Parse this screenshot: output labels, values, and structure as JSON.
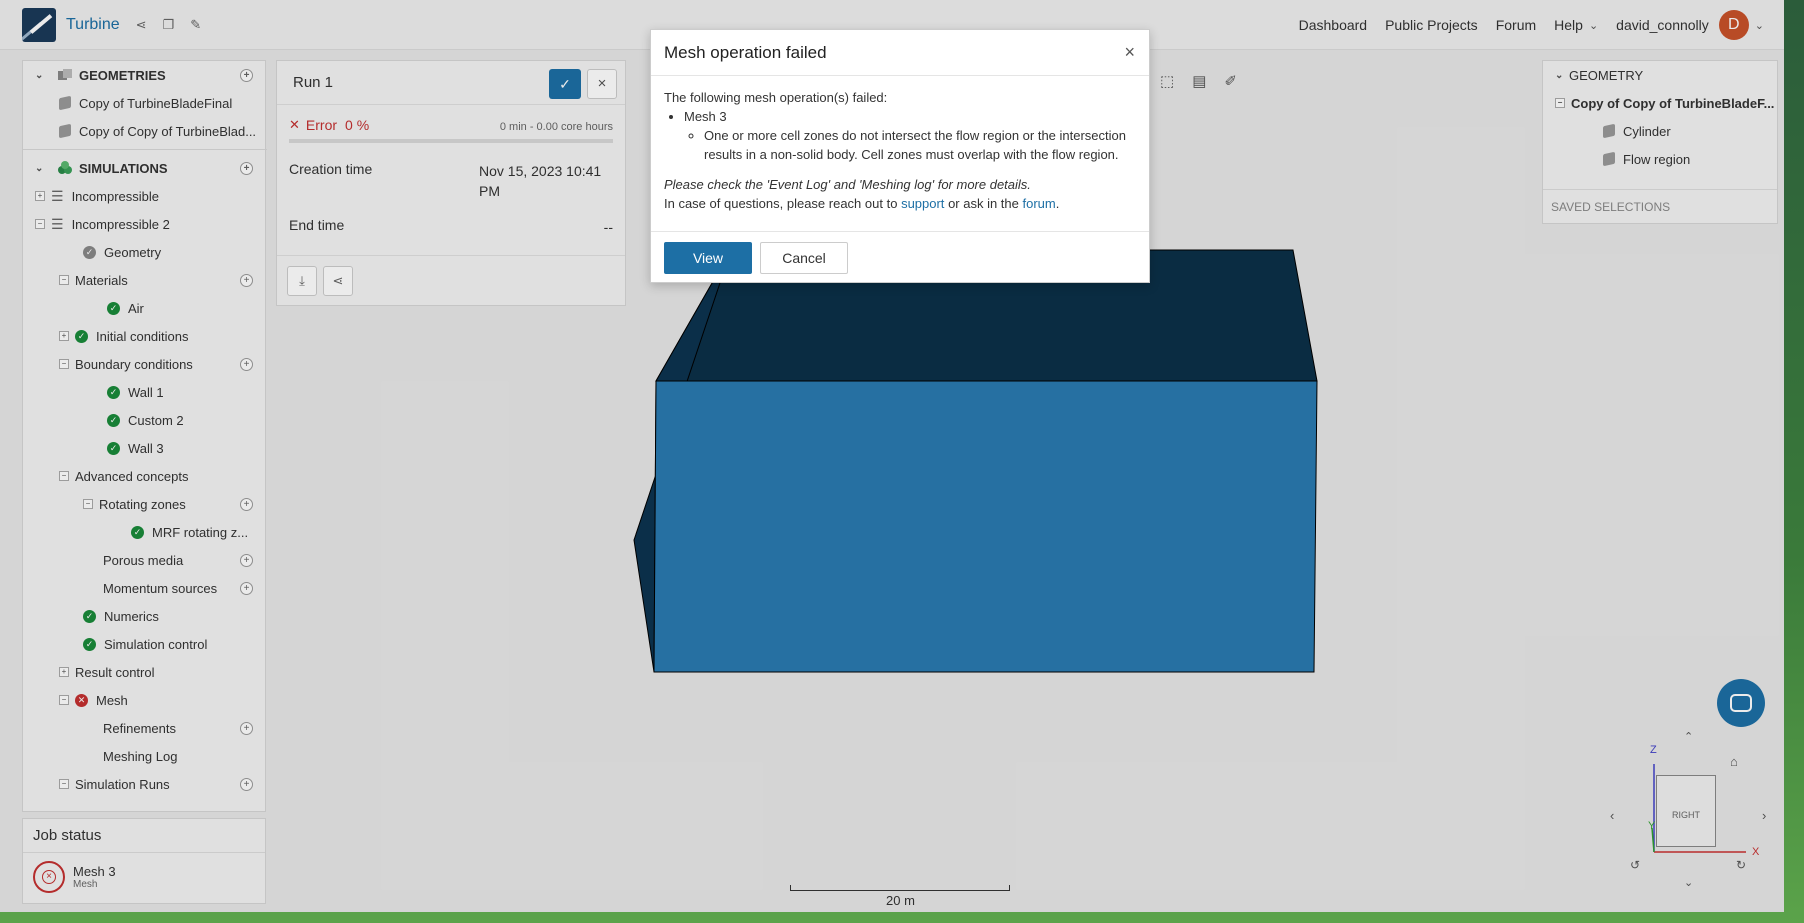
{
  "topbar": {
    "project_name": "Turbine",
    "nav": [
      "Dashboard",
      "Public Projects",
      "Forum",
      "Help"
    ],
    "username": "david_connolly",
    "avatar_initial": "D"
  },
  "left_panel": {
    "geometries_title": "GEOMETRIES",
    "geometries": [
      "Copy of TurbineBladeFinal",
      "Copy of Copy of TurbineBlad..."
    ],
    "simulations_title": "SIMULATIONS",
    "tree": {
      "incompressible": "Incompressible",
      "incompressible2": "Incompressible 2",
      "geometry": "Geometry",
      "materials": "Materials",
      "air": "Air",
      "initial_conditions": "Initial conditions",
      "boundary_conditions": "Boundary conditions",
      "wall1": "Wall 1",
      "custom2": "Custom 2",
      "wall3": "Wall 3",
      "advanced_concepts": "Advanced concepts",
      "rotating_zones": "Rotating zones",
      "mrf": "MRF rotating z...",
      "porous_media": "Porous media",
      "momentum_sources": "Momentum sources",
      "numerics": "Numerics",
      "simulation_control": "Simulation control",
      "result_control": "Result control",
      "mesh": "Mesh",
      "refinements": "Refinements",
      "meshing_log": "Meshing Log",
      "simulation_runs": "Simulation Runs"
    }
  },
  "job_status": {
    "title": "Job status",
    "job_name": "Mesh 3",
    "job_type": "Mesh"
  },
  "run_panel": {
    "title": "Run 1",
    "status": "Error",
    "percent": "0 %",
    "core_hours": "0 min - 0.00 core hours",
    "creation_label": "Creation time",
    "creation_value": "Nov 15, 2023 10:41 PM",
    "end_label": "End time",
    "end_value": "--"
  },
  "right_panel": {
    "title": "GEOMETRY",
    "root": "Copy of Copy of TurbineBladeF...",
    "items": [
      "Cylinder",
      "Flow region"
    ],
    "saved_selections": "SAVED SELECTIONS"
  },
  "viewport": {
    "scale_label": "20 m",
    "cube_face": "RIGHT",
    "axis_x": "X",
    "axis_y": "Y",
    "axis_z": "Z"
  },
  "modal": {
    "title": "Mesh operation failed",
    "intro": "The following mesh operation(s) failed:",
    "op_name": "Mesh 3",
    "reason": "One or more cell zones do not intersect the flow region or the intersection results in a non-solid body. Cell zones must overlap with the flow region.",
    "check_note": "Please check the 'Event Log' and 'Meshing log' for more details.",
    "contact_prefix": "In case of questions, please reach out to",
    "support_link": "support",
    "contact_mid": "or ask in the",
    "forum_link": "forum",
    "contact_suffix": ".",
    "view_label": "View",
    "cancel_label": "Cancel"
  },
  "colors": {
    "accent": "#1d6fa5",
    "error": "#c43030",
    "success": "#1a8a3a",
    "box_face": "#2a7ab0",
    "box_top": "#0b3048"
  }
}
